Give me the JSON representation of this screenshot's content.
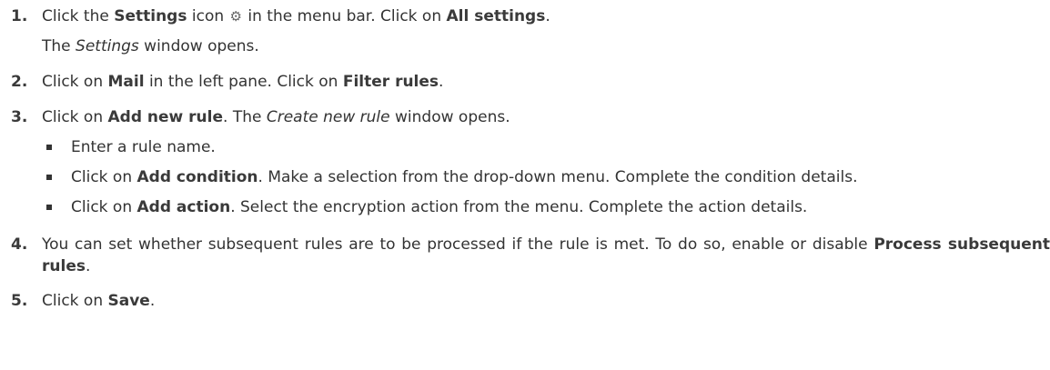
{
  "steps": [
    {
      "number": "1.",
      "parts": [
        "Click the ",
        "Settings",
        " icon ",
        " in the menu bar. Click on ",
        "All settings",
        "."
      ],
      "icon": "gear-icon",
      "icon_glyph": "⚙",
      "result": [
        "The ",
        "Settings",
        " window opens."
      ]
    },
    {
      "number": "2.",
      "parts": [
        "Click on ",
        "Mail",
        " in the left pane. Click on ",
        "Filter rules",
        "."
      ]
    },
    {
      "number": "3.",
      "parts": [
        "Click on ",
        "Add new rule",
        ". The ",
        "Create new rule",
        " window opens."
      ],
      "bullets": [
        {
          "parts": [
            "Enter a rule name."
          ]
        },
        {
          "parts": [
            "Click on ",
            "Add condition",
            ". Make a selection from the drop-down menu. Complete the condition details."
          ]
        },
        {
          "parts": [
            "Click on ",
            "Add action",
            ". Select the encryption action from the menu. Complete the action details."
          ]
        }
      ]
    },
    {
      "number": "4.",
      "parts": [
        "You can set whether subsequent rules are to be processed if the rule is met. To do so, enable or disable ",
        "Process subsequent rules",
        "."
      ]
    },
    {
      "number": "5.",
      "parts": [
        "Click on ",
        "Save",
        "."
      ]
    }
  ]
}
